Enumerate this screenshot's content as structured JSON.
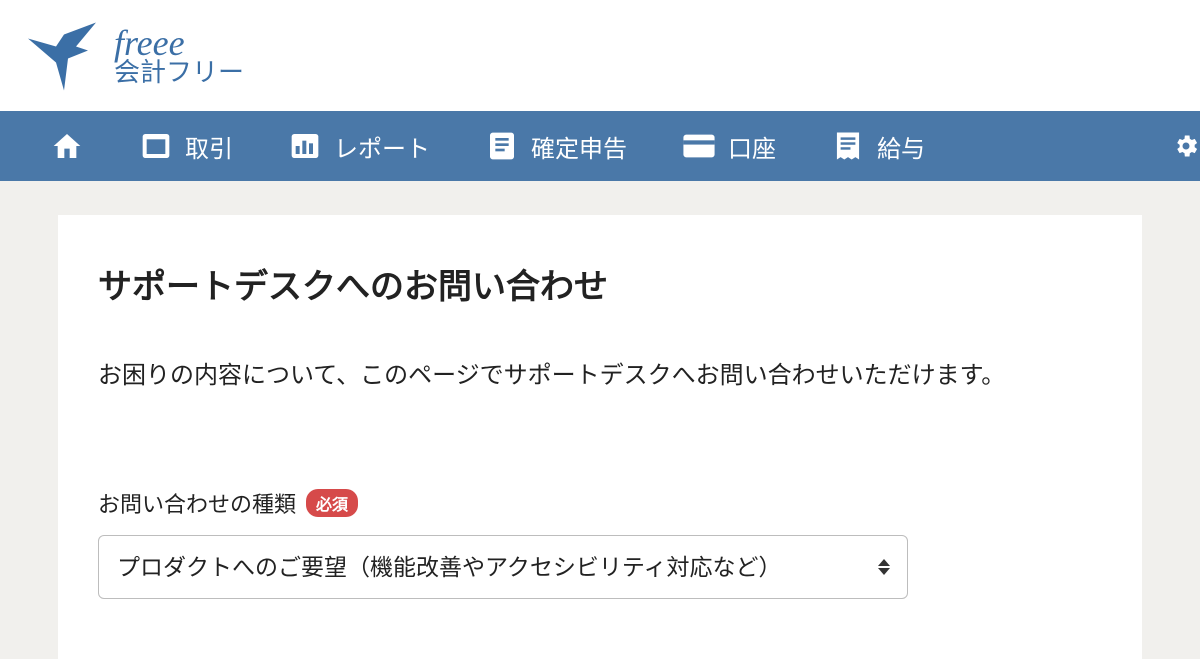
{
  "logo": {
    "script": "freee",
    "sub": "会計フリー"
  },
  "nav": {
    "items": [
      {
        "label": ""
      },
      {
        "label": "取引"
      },
      {
        "label": "レポート"
      },
      {
        "label": "確定申告"
      },
      {
        "label": "口座"
      },
      {
        "label": "給与"
      }
    ]
  },
  "page": {
    "title": "サポートデスクへのお問い合わせ",
    "description": "お困りの内容について、このページでサポートデスクへお問い合わせいただけます。"
  },
  "form": {
    "inquiry_type": {
      "label": "お問い合わせの種類",
      "required_badge": "必須",
      "selected": "プロダクトへのご要望（機能改善やアクセシビリティ対応など）"
    }
  }
}
